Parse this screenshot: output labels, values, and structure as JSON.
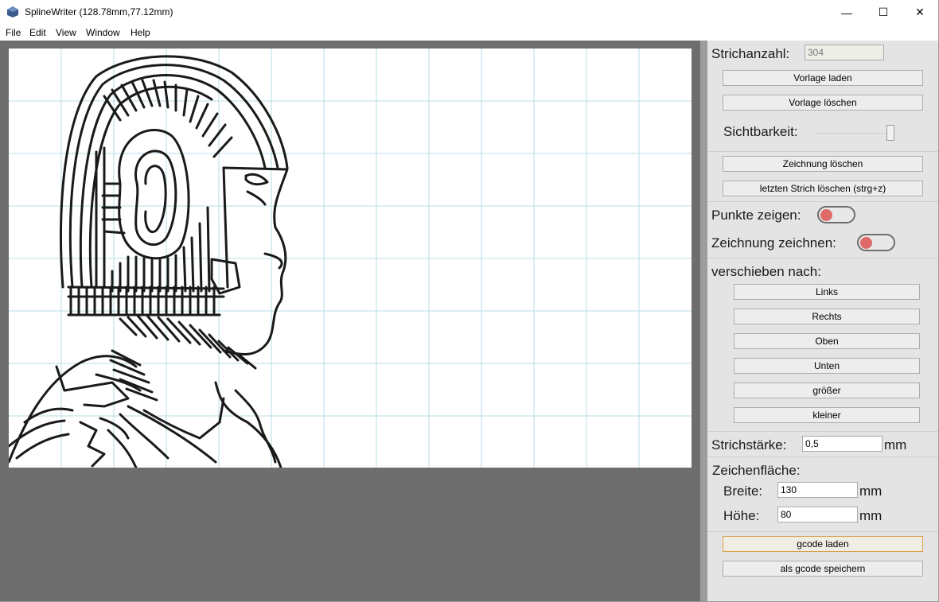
{
  "window": {
    "title": "SplineWriter (128.78mm,77.12mm)",
    "controls": {
      "minimize": "—",
      "maximize": "☐",
      "close": "✕"
    }
  },
  "menu": [
    "File",
    "Edit",
    "View",
    "Window",
    "Help"
  ],
  "panel": {
    "stroke_count_label": "Strichanzahl:",
    "stroke_count_value": "304",
    "load_template": "Vorlage laden",
    "delete_template": "Vorlage löschen",
    "visibility_label": "Sichtbarkeit:",
    "clear_drawing": "Zeichnung löschen",
    "undo_last_stroke": "letzten Strich löschen (strg+z)",
    "show_points_label": "Punkte zeigen:",
    "draw_drawing_label": "Zeichnung zeichnen:",
    "move_to_label": "verschieben nach:",
    "move_left": "Links",
    "move_right": "Rechts",
    "move_up": "Oben",
    "move_down": "Unten",
    "bigger": "größer",
    "smaller": "kleiner",
    "stroke_width_label": "Strichstärke:",
    "stroke_width_value": "0,5",
    "unit_mm": "mm",
    "canvas_label": "Zeichenfläche:",
    "width_label": "Breite:",
    "width_value": "130",
    "height_label": "Höhe:",
    "height_value": "80",
    "load_gcode": "gcode laden",
    "save_gcode": "als gcode speichern"
  },
  "colors": {
    "grid": "#b9dde6",
    "workspace": "#6e6e6e",
    "panel": "#e4e4e4",
    "toggle_knob": "#e06a6a",
    "stroke": "#1a1a1a"
  }
}
